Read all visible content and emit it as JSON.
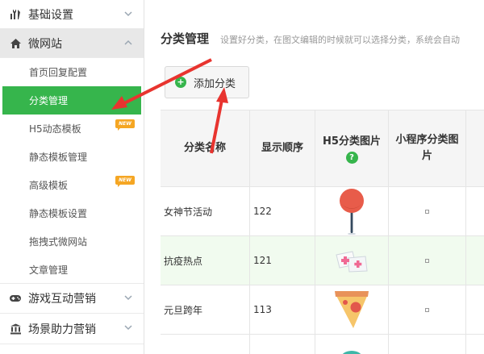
{
  "sidebar": {
    "groups": [
      {
        "label": "基础设置",
        "icon": "tools-icon",
        "expanded": false
      },
      {
        "label": "微网站",
        "icon": "home-icon",
        "expanded": true
      },
      {
        "label": "游戏互动营销",
        "icon": "gamepad-icon",
        "expanded": false
      },
      {
        "label": "场景助力营销",
        "icon": "bank-icon",
        "expanded": false
      }
    ],
    "items": [
      {
        "label": "首页回复配置",
        "active": false,
        "badge": ""
      },
      {
        "label": "分类管理",
        "active": true,
        "badge": ""
      },
      {
        "label": "H5动态模板",
        "active": false,
        "badge": "NEW"
      },
      {
        "label": "静态模板管理",
        "active": false,
        "badge": ""
      },
      {
        "label": "高级模板",
        "active": false,
        "badge": "NEW"
      },
      {
        "label": "静态模板设置",
        "active": false,
        "badge": ""
      },
      {
        "label": "拖拽式微网站",
        "active": false,
        "badge": ""
      },
      {
        "label": "文章管理",
        "active": false,
        "badge": ""
      }
    ]
  },
  "main": {
    "title": "分类管理",
    "description": "设置好分类，在图文编辑的时候就可以选择分类，系统会自动",
    "add_button": "添加分类"
  },
  "table": {
    "headers": [
      "分类名称",
      "显示顺序",
      "H5分类图片",
      "小程序分类图片",
      ""
    ],
    "help_icon": "?",
    "rows": [
      {
        "name": "女神节活动",
        "order": "122",
        "image": "pin-icon",
        "highlight": false
      },
      {
        "name": "抗疫热点",
        "order": "121",
        "image": "nurse-cap-icon",
        "highlight": true
      },
      {
        "name": "元旦跨年",
        "order": "113",
        "image": "pizza-icon",
        "highlight": false
      }
    ]
  },
  "colors": {
    "accent": "#36b54c",
    "arrow": "#e8342f",
    "badge": "#f5a623"
  }
}
